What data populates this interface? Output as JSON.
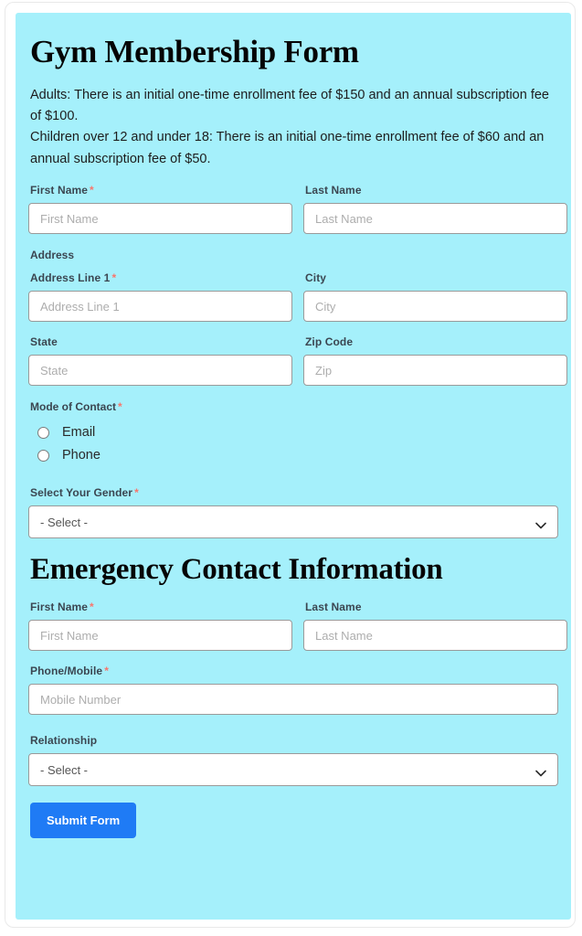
{
  "form": {
    "title": "Gym Membership Form",
    "intro_line_1": "Adults: There is an initial one-time enrollment fee of $150 and an annual subscription fee of $100.",
    "intro_line_2": "Children over 12 and under 18: There is an initial one-time enrollment fee of $60 and an annual subscription fee of $50.",
    "required_marker": "*",
    "background_color": "#a5f0fb",
    "accent_color": "#1f7bf5",
    "required_color": "#f8766d",
    "personal": {
      "first_name": {
        "label": "First Name",
        "placeholder": "First Name",
        "value": ""
      },
      "last_name": {
        "label": "Last Name",
        "placeholder": "Last Name",
        "value": ""
      },
      "address_heading": "Address",
      "address_line_1": {
        "label": "Address Line 1",
        "placeholder": "Address Line 1",
        "value": ""
      },
      "city": {
        "label": "City",
        "placeholder": "City",
        "value": ""
      },
      "state": {
        "label": "State",
        "placeholder": "State",
        "value": ""
      },
      "zip": {
        "label": "Zip Code",
        "placeholder": "Zip",
        "value": ""
      },
      "mode_of_contact": {
        "label": "Mode of Contact",
        "options": [
          {
            "label": "Email",
            "checked": false
          },
          {
            "label": "Phone",
            "checked": false
          }
        ]
      },
      "gender": {
        "label": "Select Your Gender",
        "selected": "- Select -",
        "options": [
          "- Select -"
        ]
      }
    },
    "emergency": {
      "section_title": "Emergency Contact Information",
      "first_name": {
        "label": "First Name",
        "placeholder": "First Name",
        "value": ""
      },
      "last_name": {
        "label": "Last Name",
        "placeholder": "Last Name",
        "value": ""
      },
      "phone_mobile": {
        "label": "Phone/Mobile",
        "placeholder": "Mobile Number",
        "value": ""
      },
      "relationship": {
        "label": "Relationship",
        "selected": "- Select -",
        "options": [
          "- Select -"
        ]
      }
    },
    "submit_label": "Submit Form"
  }
}
